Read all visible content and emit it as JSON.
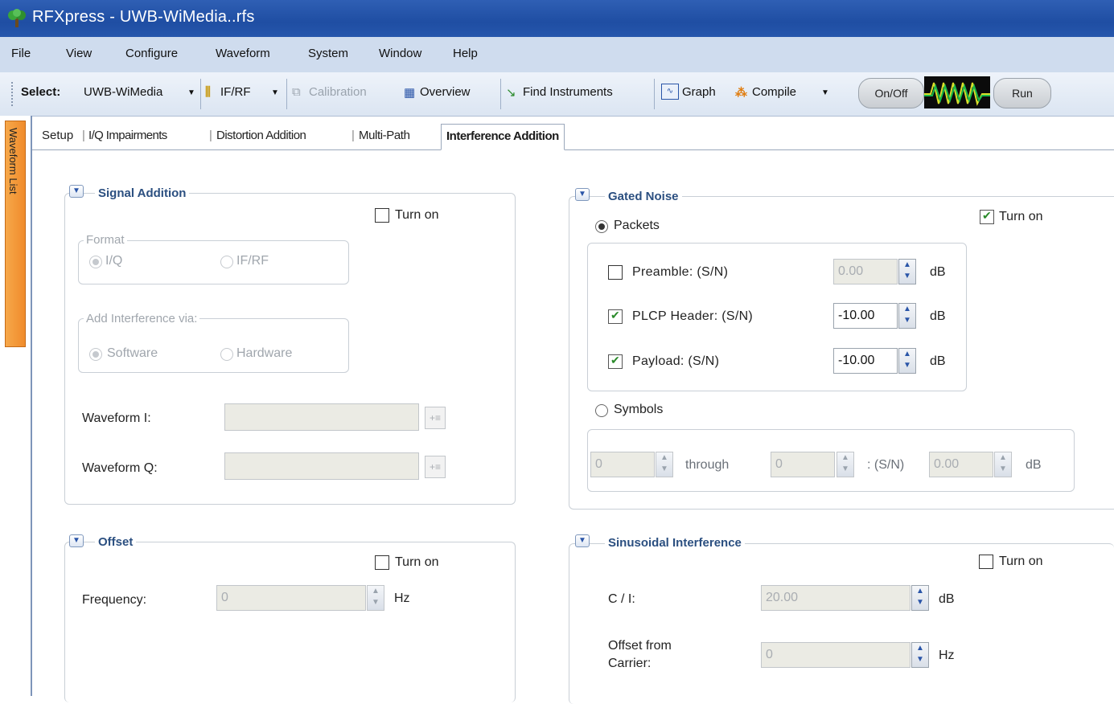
{
  "window": {
    "title": "RFXpress - UWB-WiMedia..rfs"
  },
  "menu": [
    "File",
    "View",
    "Configure",
    "Waveform",
    "System",
    "Window",
    "Help"
  ],
  "toolbar": {
    "select_label": "Select:",
    "select_value": "UWB-WiMedia",
    "ifrf": "IF/RF",
    "calibration": "Calibration",
    "overview": "Overview",
    "find_instruments": "Find Instruments",
    "graph": "Graph",
    "compile": "Compile",
    "onoff": "On/Off",
    "run": "Run"
  },
  "sidetab": "Waveform List",
  "tabs": [
    "Setup",
    "I/Q Impairments",
    "Distortion Addition",
    "Multi-Path",
    "Interference Addition"
  ],
  "signal_addition": {
    "title": "Signal Addition",
    "turn_on": "Turn on",
    "format_title": "Format",
    "format_options": [
      "I/Q",
      "IF/RF"
    ],
    "add_via_title": "Add Interference via:",
    "add_via_options": [
      "Software",
      "Hardware"
    ],
    "waveform_i": "Waveform I:",
    "waveform_q": "Waveform Q:"
  },
  "gated_noise": {
    "title": "Gated Noise",
    "turn_on": "Turn on",
    "packets": "Packets",
    "rows": [
      {
        "label": "Preamble: (S/N)",
        "value": "0.00",
        "unit": "dB",
        "checked": false
      },
      {
        "label": "PLCP Header: (S/N)",
        "value": "-10.00",
        "unit": "dB",
        "checked": true
      },
      {
        "label": "Payload: (S/N)",
        "value": "-10.00",
        "unit": "dB",
        "checked": true
      }
    ],
    "symbols": "Symbols",
    "sym_from": "0",
    "through": "through",
    "sym_to": "0",
    "sn": ": (S/N)",
    "sym_value": "0.00",
    "sym_unit": "dB"
  },
  "offset": {
    "title": "Offset",
    "turn_on": "Turn on",
    "frequency_label": "Frequency:",
    "frequency_value": "0",
    "unit": "Hz"
  },
  "sinusoidal": {
    "title": "Sinusoidal Interference",
    "turn_on": "Turn on",
    "ci_label": "C / I:",
    "ci_value": "20.00",
    "ci_unit": "dB",
    "offset_label_1": "Offset from",
    "offset_label_2": "Carrier:",
    "offset_value": "0",
    "offset_unit": "Hz"
  }
}
